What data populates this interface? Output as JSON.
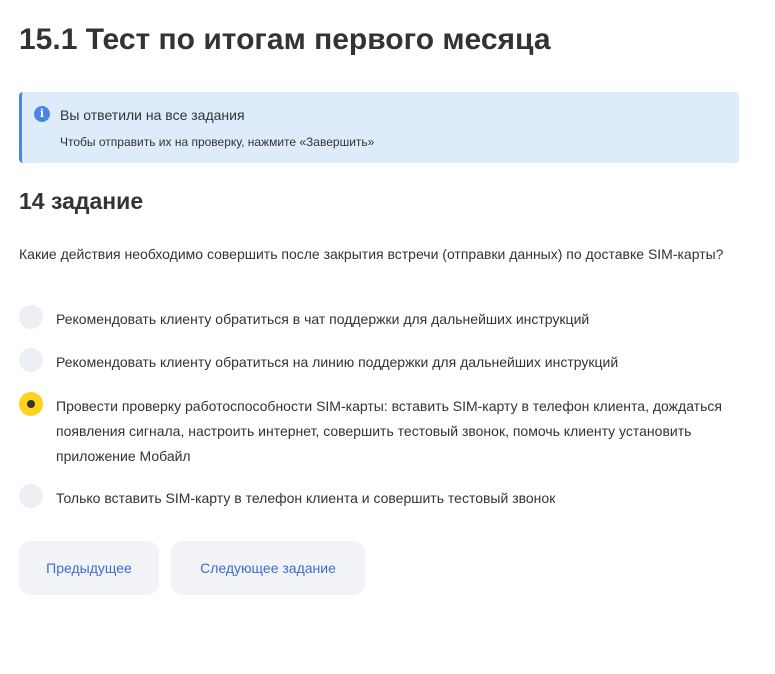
{
  "page": {
    "title": "15.1 Тест по итогам первого месяца"
  },
  "notice": {
    "icon": "info-icon",
    "icon_glyph": "i",
    "title": "Вы ответили на все задания",
    "text": "Чтобы отправить их на проверку, нажмите «Завершить»",
    "accent_color": "#4a86e8",
    "background_color": "#deebfb"
  },
  "task": {
    "title": "14 задание",
    "question": "Какие действия необходимо совершить после закрытия встречи (отправки данных) по доставке SIM-карты?",
    "options": [
      {
        "label": "Рекомендовать клиенту обратиться в чат поддержки для дальнейших инструкций",
        "selected": false
      },
      {
        "label": "Рекомендовать клиенту обратиться на линию поддержки для дальнейших инструкций",
        "selected": false
      },
      {
        "label": "Провести проверку работоспособности SIM-карты: вставить SIM-карту в телефон клиента, дождаться появления сигнала, настроить интернет, совершить тестовый звонок, помочь клиенту установить приложение Мобайл",
        "selected": true
      },
      {
        "label": "Только вставить SIM-карту в телефон клиента и совершить тестовый звонок",
        "selected": false
      }
    ],
    "selected_color": "#ffd21e"
  },
  "navigation": {
    "previous_label": "Предыдущее",
    "next_label": "Следующее задание",
    "button_text_color": "#3f6ccd"
  }
}
